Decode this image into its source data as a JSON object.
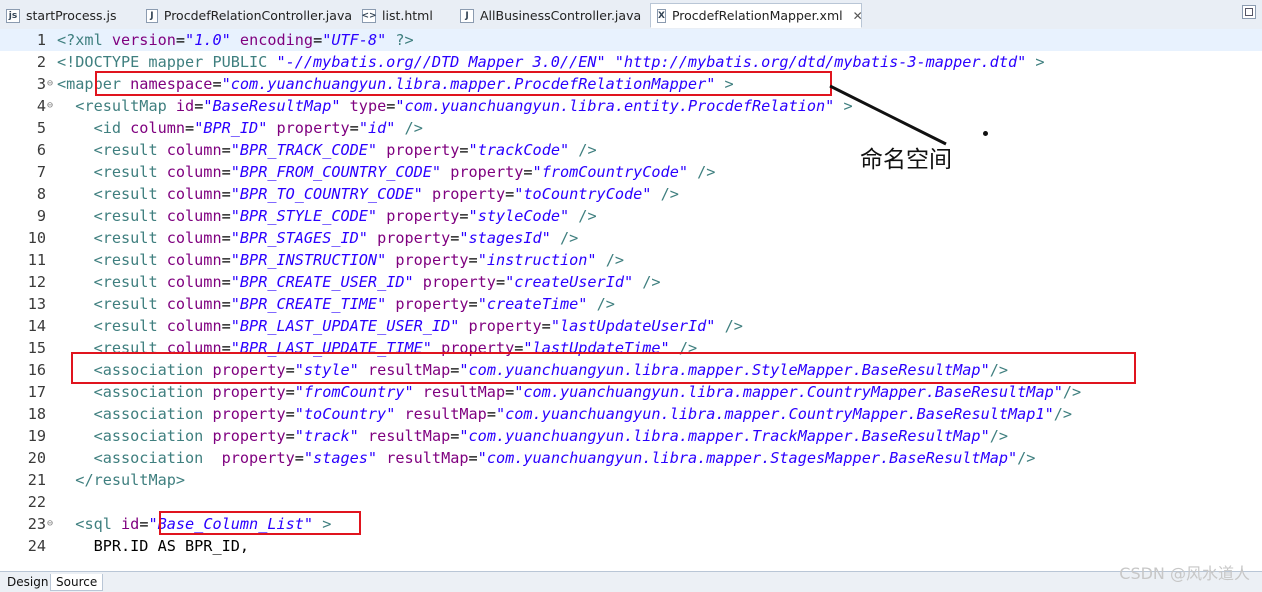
{
  "tabs": [
    {
      "label": "startProcess.js",
      "icon": "js-file-icon"
    },
    {
      "label": "ProcdefRelationController.java",
      "icon": "java-file-icon"
    },
    {
      "label": "list.html",
      "icon": "html-file-icon"
    },
    {
      "label": "AllBusinessController.java",
      "icon": "java-file-icon"
    },
    {
      "label": "ProcdefRelationMapper.xml",
      "icon": "xml-file-icon",
      "active": true
    }
  ],
  "close_glyph": "✕",
  "lines": [
    {
      "n": "1",
      "fold": "",
      "segs": [
        [
          "t",
          "<?xml "
        ],
        [
          "a",
          "version"
        ],
        [
          "plain",
          "="
        ],
        [
          "v",
          "\"1.0\""
        ],
        [
          "plain",
          " "
        ],
        [
          "a",
          "encoding"
        ],
        [
          "plain",
          "="
        ],
        [
          "v",
          "\"UTF-8\""
        ],
        [
          "plain",
          " "
        ],
        [
          "t",
          "?>"
        ]
      ]
    },
    {
      "n": "2",
      "fold": "",
      "segs": [
        [
          "d",
          "<!DOCTYPE mapper PUBLIC "
        ],
        [
          "v",
          "\"-//mybatis.org//DTD Mapper 3.0//EN\""
        ],
        [
          "d",
          " "
        ],
        [
          "v",
          "\"http://mybatis.org/dtd/mybatis-3-mapper.dtd\""
        ],
        [
          "d",
          " >"
        ]
      ]
    },
    {
      "n": "3",
      "fold": "⊖",
      "segs": [
        [
          "t",
          "<mapper "
        ],
        [
          "a",
          "namespace"
        ],
        [
          "plain",
          "="
        ],
        [
          "v",
          "\"com.yuanchuangyun.libra.mapper.ProcdefRelationMapper\""
        ],
        [
          "plain",
          " "
        ],
        [
          "t",
          ">"
        ]
      ]
    },
    {
      "n": "4",
      "fold": "⊖",
      "segs": [
        [
          "plain",
          "  "
        ],
        [
          "t",
          "<resultMap "
        ],
        [
          "a",
          "id"
        ],
        [
          "plain",
          "="
        ],
        [
          "v",
          "\"BaseResultMap\""
        ],
        [
          "plain",
          " "
        ],
        [
          "a",
          "type"
        ],
        [
          "plain",
          "="
        ],
        [
          "v",
          "\"com.yuanchuangyun.libra.entity.ProcdefRelation\""
        ],
        [
          "plain",
          " "
        ],
        [
          "t",
          ">"
        ]
      ]
    },
    {
      "n": "5",
      "fold": "",
      "segs": [
        [
          "plain",
          "    "
        ],
        [
          "t",
          "<id "
        ],
        [
          "a",
          "column"
        ],
        [
          "plain",
          "="
        ],
        [
          "v",
          "\"BPR_ID\""
        ],
        [
          "plain",
          " "
        ],
        [
          "a",
          "property"
        ],
        [
          "plain",
          "="
        ],
        [
          "v",
          "\"id\""
        ],
        [
          "plain",
          " "
        ],
        [
          "t",
          "/>"
        ]
      ]
    },
    {
      "n": "6",
      "fold": "",
      "segs": [
        [
          "plain",
          "    "
        ],
        [
          "t",
          "<result "
        ],
        [
          "a",
          "column"
        ],
        [
          "plain",
          "="
        ],
        [
          "v",
          "\"BPR_TRACK_CODE\""
        ],
        [
          "plain",
          " "
        ],
        [
          "a",
          "property"
        ],
        [
          "plain",
          "="
        ],
        [
          "v",
          "\"trackCode\""
        ],
        [
          "plain",
          " "
        ],
        [
          "t",
          "/>"
        ]
      ]
    },
    {
      "n": "7",
      "fold": "",
      "segs": [
        [
          "plain",
          "    "
        ],
        [
          "t",
          "<result "
        ],
        [
          "a",
          "column"
        ],
        [
          "plain",
          "="
        ],
        [
          "v",
          "\"BPR_FROM_COUNTRY_CODE\""
        ],
        [
          "plain",
          " "
        ],
        [
          "a",
          "property"
        ],
        [
          "plain",
          "="
        ],
        [
          "v",
          "\"fromCountryCode\""
        ],
        [
          "plain",
          " "
        ],
        [
          "t",
          "/>"
        ]
      ]
    },
    {
      "n": "8",
      "fold": "",
      "segs": [
        [
          "plain",
          "    "
        ],
        [
          "t",
          "<result "
        ],
        [
          "a",
          "column"
        ],
        [
          "plain",
          "="
        ],
        [
          "v",
          "\"BPR_TO_COUNTRY_CODE\""
        ],
        [
          "plain",
          " "
        ],
        [
          "a",
          "property"
        ],
        [
          "plain",
          "="
        ],
        [
          "v",
          "\"toCountryCode\""
        ],
        [
          "plain",
          " "
        ],
        [
          "t",
          "/>"
        ]
      ]
    },
    {
      "n": "9",
      "fold": "",
      "segs": [
        [
          "plain",
          "    "
        ],
        [
          "t",
          "<result "
        ],
        [
          "a",
          "column"
        ],
        [
          "plain",
          "="
        ],
        [
          "v",
          "\"BPR_STYLE_CODE\""
        ],
        [
          "plain",
          " "
        ],
        [
          "a",
          "property"
        ],
        [
          "plain",
          "="
        ],
        [
          "v",
          "\"styleCode\""
        ],
        [
          "plain",
          " "
        ],
        [
          "t",
          "/>"
        ]
      ]
    },
    {
      "n": "10",
      "fold": "",
      "segs": [
        [
          "plain",
          "    "
        ],
        [
          "t",
          "<result "
        ],
        [
          "a",
          "column"
        ],
        [
          "plain",
          "="
        ],
        [
          "v",
          "\"BPR_STAGES_ID\""
        ],
        [
          "plain",
          " "
        ],
        [
          "a",
          "property"
        ],
        [
          "plain",
          "="
        ],
        [
          "v",
          "\"stagesId\""
        ],
        [
          "plain",
          " "
        ],
        [
          "t",
          "/>"
        ]
      ]
    },
    {
      "n": "11",
      "fold": "",
      "segs": [
        [
          "plain",
          "    "
        ],
        [
          "t",
          "<result "
        ],
        [
          "a",
          "column"
        ],
        [
          "plain",
          "="
        ],
        [
          "v",
          "\"BPR_INSTRUCTION\""
        ],
        [
          "plain",
          " "
        ],
        [
          "a",
          "property"
        ],
        [
          "plain",
          "="
        ],
        [
          "v",
          "\"instruction\""
        ],
        [
          "plain",
          " "
        ],
        [
          "t",
          "/>"
        ]
      ]
    },
    {
      "n": "12",
      "fold": "",
      "segs": [
        [
          "plain",
          "    "
        ],
        [
          "t",
          "<result "
        ],
        [
          "a",
          "column"
        ],
        [
          "plain",
          "="
        ],
        [
          "v",
          "\"BPR_CREATE_USER_ID\""
        ],
        [
          "plain",
          " "
        ],
        [
          "a",
          "property"
        ],
        [
          "plain",
          "="
        ],
        [
          "v",
          "\"createUserId\""
        ],
        [
          "plain",
          " "
        ],
        [
          "t",
          "/>"
        ]
      ]
    },
    {
      "n": "13",
      "fold": "",
      "segs": [
        [
          "plain",
          "    "
        ],
        [
          "t",
          "<result "
        ],
        [
          "a",
          "column"
        ],
        [
          "plain",
          "="
        ],
        [
          "v",
          "\"BPR_CREATE_TIME\""
        ],
        [
          "plain",
          " "
        ],
        [
          "a",
          "property"
        ],
        [
          "plain",
          "="
        ],
        [
          "v",
          "\"createTime\""
        ],
        [
          "plain",
          " "
        ],
        [
          "t",
          "/>"
        ]
      ]
    },
    {
      "n": "14",
      "fold": "",
      "segs": [
        [
          "plain",
          "    "
        ],
        [
          "t",
          "<result "
        ],
        [
          "a",
          "column"
        ],
        [
          "plain",
          "="
        ],
        [
          "v",
          "\"BPR_LAST_UPDATE_USER_ID\""
        ],
        [
          "plain",
          " "
        ],
        [
          "a",
          "property"
        ],
        [
          "plain",
          "="
        ],
        [
          "v",
          "\"lastUpdateUserId\""
        ],
        [
          "plain",
          " "
        ],
        [
          "t",
          "/>"
        ]
      ]
    },
    {
      "n": "15",
      "fold": "",
      "segs": [
        [
          "plain",
          "    "
        ],
        [
          "t",
          "<result "
        ],
        [
          "a",
          "column"
        ],
        [
          "plain",
          "="
        ],
        [
          "v",
          "\"BPR_LAST_UPDATE_TIME\""
        ],
        [
          "plain",
          " "
        ],
        [
          "a",
          "property"
        ],
        [
          "plain",
          "="
        ],
        [
          "v",
          "\"lastUpdateTime\""
        ],
        [
          "plain",
          " "
        ],
        [
          "t",
          "/>"
        ]
      ]
    },
    {
      "n": "16",
      "fold": "",
      "segs": [
        [
          "plain",
          "    "
        ],
        [
          "t",
          "<association "
        ],
        [
          "a",
          "property"
        ],
        [
          "plain",
          "="
        ],
        [
          "v",
          "\"style\""
        ],
        [
          "plain",
          " "
        ],
        [
          "a",
          "resultMap"
        ],
        [
          "plain",
          "="
        ],
        [
          "v",
          "\"com.yuanchuangyun.libra.mapper.StyleMapper.BaseResultMap\""
        ],
        [
          "t",
          "/>"
        ]
      ]
    },
    {
      "n": "17",
      "fold": "",
      "segs": [
        [
          "plain",
          "    "
        ],
        [
          "t",
          "<association "
        ],
        [
          "a",
          "property"
        ],
        [
          "plain",
          "="
        ],
        [
          "v",
          "\"fromCountry\""
        ],
        [
          "plain",
          " "
        ],
        [
          "a",
          "resultMap"
        ],
        [
          "plain",
          "="
        ],
        [
          "v",
          "\"com.yuanchuangyun.libra.mapper.CountryMapper.BaseResultMap\""
        ],
        [
          "t",
          "/>"
        ]
      ]
    },
    {
      "n": "18",
      "fold": "",
      "segs": [
        [
          "plain",
          "    "
        ],
        [
          "t",
          "<association "
        ],
        [
          "a",
          "property"
        ],
        [
          "plain",
          "="
        ],
        [
          "v",
          "\"toCountry\""
        ],
        [
          "plain",
          " "
        ],
        [
          "a",
          "resultMap"
        ],
        [
          "plain",
          "="
        ],
        [
          "v",
          "\"com.yuanchuangyun.libra.mapper.CountryMapper.BaseResultMap1\""
        ],
        [
          "t",
          "/>"
        ]
      ]
    },
    {
      "n": "19",
      "fold": "",
      "segs": [
        [
          "plain",
          "    "
        ],
        [
          "t",
          "<association "
        ],
        [
          "a",
          "property"
        ],
        [
          "plain",
          "="
        ],
        [
          "v",
          "\"track\""
        ],
        [
          "plain",
          " "
        ],
        [
          "a",
          "resultMap"
        ],
        [
          "plain",
          "="
        ],
        [
          "v",
          "\"com.yuanchuangyun.libra.mapper.TrackMapper.BaseResultMap\""
        ],
        [
          "t",
          "/>"
        ]
      ]
    },
    {
      "n": "20",
      "fold": "",
      "segs": [
        [
          "plain",
          "    "
        ],
        [
          "t",
          "<association  "
        ],
        [
          "a",
          "property"
        ],
        [
          "plain",
          "="
        ],
        [
          "v",
          "\"stages\""
        ],
        [
          "plain",
          " "
        ],
        [
          "a",
          "resultMap"
        ],
        [
          "plain",
          "="
        ],
        [
          "v",
          "\"com.yuanchuangyun.libra.mapper.StagesMapper.BaseResultMap\""
        ],
        [
          "t",
          "/>"
        ]
      ]
    },
    {
      "n": "21",
      "fold": "",
      "segs": [
        [
          "plain",
          "  "
        ],
        [
          "t",
          "</resultMap>"
        ]
      ]
    },
    {
      "n": "22",
      "fold": "",
      "segs": []
    },
    {
      "n": "23",
      "fold": "⊖",
      "segs": [
        [
          "plain",
          "  "
        ],
        [
          "t",
          "<sql "
        ],
        [
          "a",
          "id"
        ],
        [
          "plain",
          "="
        ],
        [
          "v",
          "\"Base_Column_List\""
        ],
        [
          "plain",
          " "
        ],
        [
          "t",
          ">"
        ]
      ]
    },
    {
      "n": "24",
      "fold": "",
      "segs": [
        [
          "plain",
          "    BPR.ID AS BPR_ID,"
        ]
      ]
    }
  ],
  "annotation": {
    "label": "命名空间"
  },
  "bottom_tabs": [
    "Design",
    "Source"
  ],
  "watermark": "CSDN @风水道人",
  "colors": {
    "tag": "#3f7f7f",
    "attr": "#7f007f",
    "value": "#2a00ff",
    "highlight_box": "#e0141e"
  }
}
